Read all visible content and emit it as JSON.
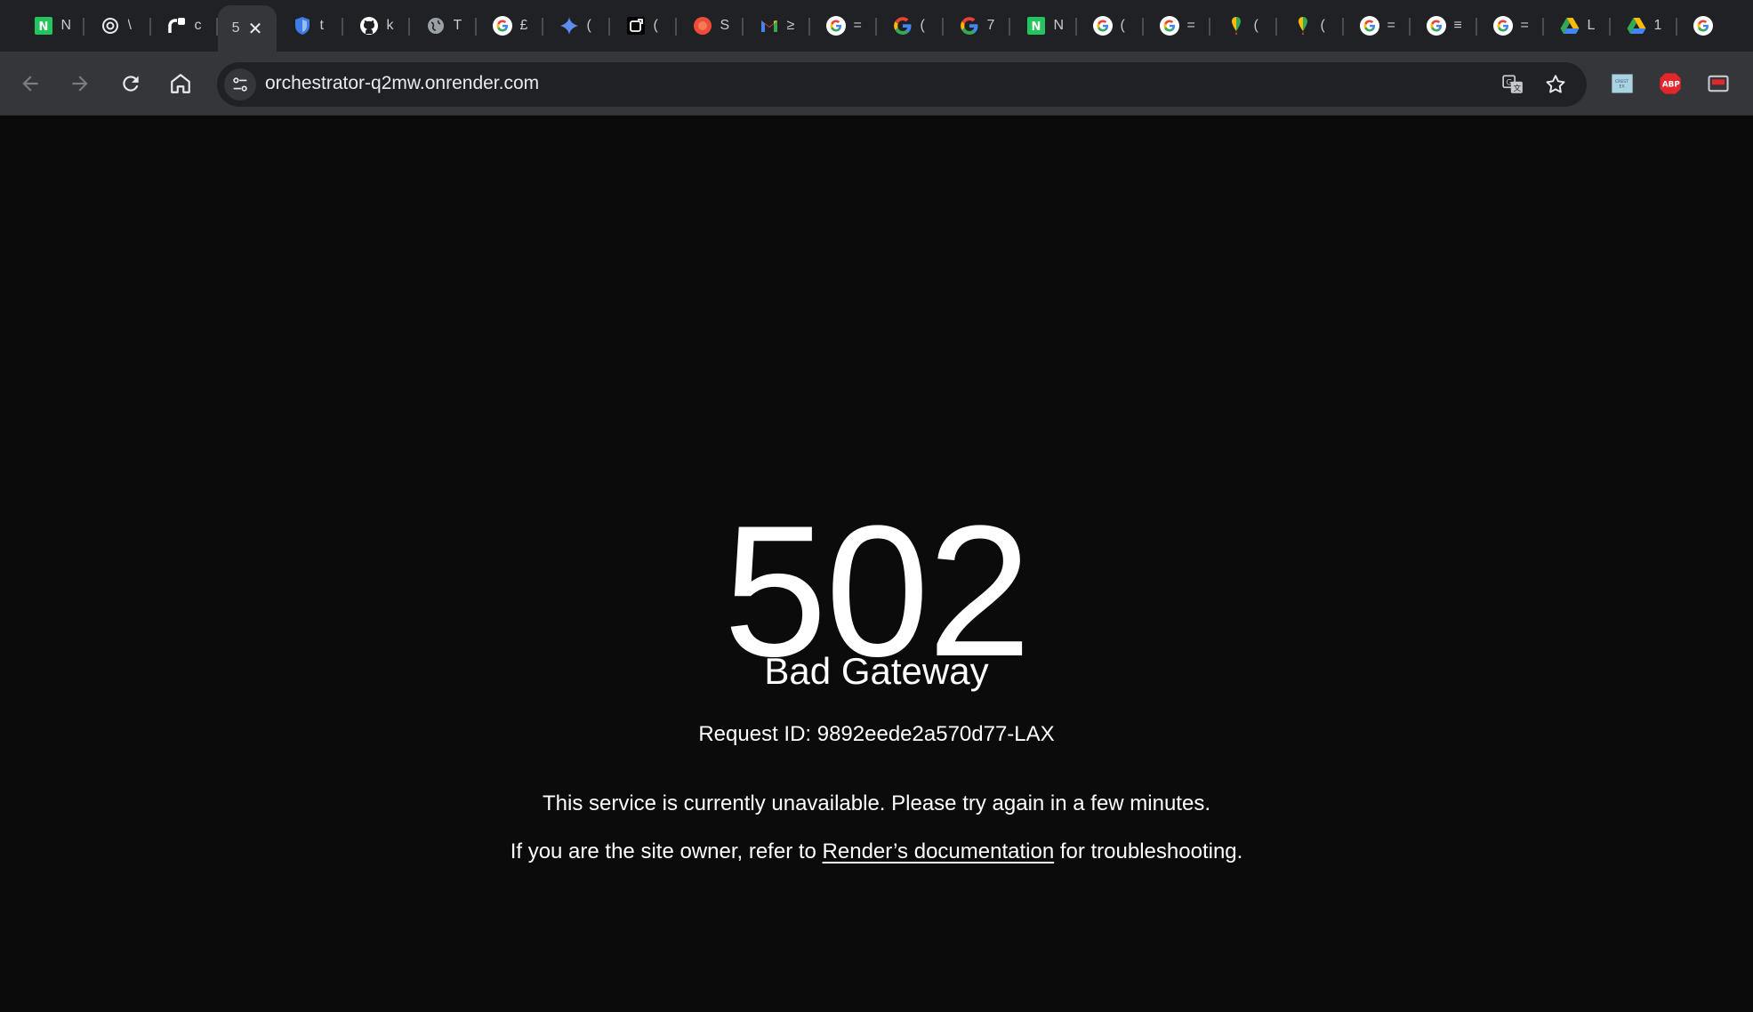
{
  "browser": {
    "tabs": [
      {
        "icon": "notion-like-green-n-icon",
        "cut": "N"
      },
      {
        "icon": "openai-icon",
        "cut": "\\"
      },
      {
        "icon": "render-logo-icon",
        "cut": "c"
      },
      {
        "icon": "active",
        "cut": "5",
        "close": "✕"
      },
      {
        "icon": "bitwarden-shield-icon",
        "cut": "t"
      },
      {
        "icon": "github-icon",
        "cut": "k"
      },
      {
        "icon": "globe-icon",
        "cut": "T"
      },
      {
        "icon": "google-icon",
        "cut": "£"
      },
      {
        "icon": "gemini-sparkle-icon",
        "cut": "("
      },
      {
        "icon": "external-square-icon",
        "cut": "("
      },
      {
        "icon": "orange-circle-icon",
        "cut": "S"
      },
      {
        "icon": "gmail-icon",
        "cut": "≥"
      },
      {
        "icon": "google-icon",
        "cut": "="
      },
      {
        "icon": "google-g-icon",
        "cut": "("
      },
      {
        "icon": "google-g-icon",
        "cut": "7"
      },
      {
        "icon": "notion-like-green-n-icon",
        "cut": "N"
      },
      {
        "icon": "google-icon",
        "cut": "("
      },
      {
        "icon": "google-icon",
        "cut": "="
      },
      {
        "icon": "google-pin-icon",
        "cut": "("
      },
      {
        "icon": "google-pin-icon",
        "cut": "("
      },
      {
        "icon": "google-icon",
        "cut": "="
      },
      {
        "icon": "google-icon",
        "cut": "≡"
      },
      {
        "icon": "google-icon",
        "cut": "="
      },
      {
        "icon": "google-drive-icon",
        "cut": "L"
      },
      {
        "icon": "google-drive-icon",
        "cut": "1"
      },
      {
        "icon": "google-icon",
        "cut": ""
      }
    ],
    "url": "orchestrator-q2mw.onrender.com",
    "extensions": [
      "dark-reader-icon",
      "adblock-plus-icon",
      "cast-icon"
    ],
    "colors": {
      "toolbar": "#35363a",
      "tabstrip": "#1f2124",
      "page_bg": "#0b0b0b"
    }
  },
  "page": {
    "status_code": "502",
    "status_text": "Bad Gateway",
    "request_id": "Request ID: 9892eede2a570d77-LAX",
    "message": "This service is currently unavailable. Please try again in a few minutes.",
    "owner_prefix": "If you are the site owner, refer to ",
    "owner_link": "Render’s documentation",
    "owner_suffix": " for troubleshooting."
  }
}
